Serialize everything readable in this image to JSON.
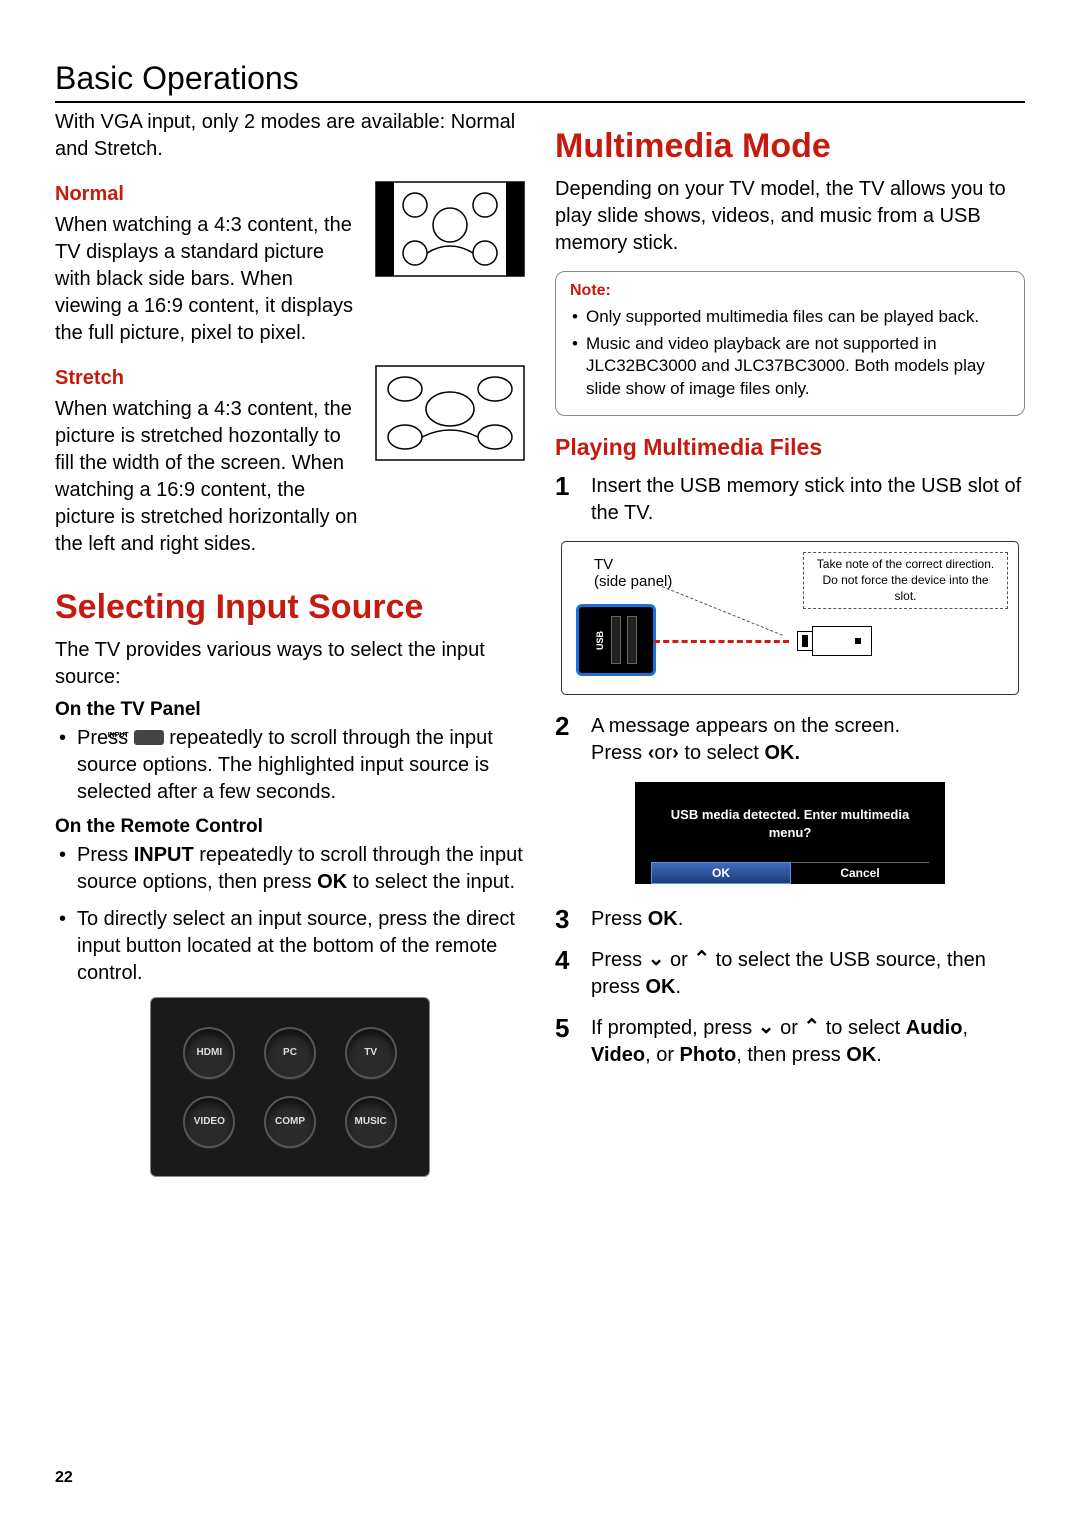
{
  "page_title": "Basic Operations",
  "page_number": "22",
  "left": {
    "intro": "With VGA input, only 2 modes are available: Normal and Stretch.",
    "normal": {
      "heading": "Normal",
      "text": "When watching a 4:3 content, the TV displays a standard picture with black side bars. When viewing a 16:9 content, it displays the full picture, pixel to pixel."
    },
    "stretch": {
      "heading": "Stretch",
      "text": "When watching a 4:3 content, the picture is stretched hozontally to fill the width of the screen. When watching a 16:9 content, the picture is stretched horizontally on the left and right sides."
    },
    "select_input": {
      "heading": "Selecting Input Source",
      "intro": "The TV provides various ways to select the input source:",
      "tv_panel": {
        "heading": "On the TV Panel",
        "bullet_pre": "Press ",
        "bullet_post": " repeatedly to scroll through the input source options. The highlighted input source is selected after a few seconds.",
        "input_label": "INPUT"
      },
      "remote": {
        "heading": "On the Remote Control",
        "b1_pre": "Press ",
        "b1_key": "INPUT",
        "b1_mid": " repeatedly to scroll through the input source options, then press ",
        "b1_key2": "OK",
        "b1_post": " to select the input.",
        "b2": "To directly select an input source, press the direct input button located at the bottom of the remote control."
      },
      "buttons": [
        "HDMI",
        "PC",
        "TV",
        "VIDEO",
        "COMP",
        "MUSIC"
      ]
    }
  },
  "right": {
    "mm_heading": "Multimedia Mode",
    "mm_intro": "Depending on your TV model, the TV allows you to play slide shows, videos, and music from a USB memory stick.",
    "note": {
      "title": "Note:",
      "items": [
        "Only supported multimedia files can be played back.",
        "Music and video playback are not supported in JLC32BC3000 and JLC37BC3000. Both models play slide show of image files only."
      ]
    },
    "playing_heading": "Playing Multimedia Files",
    "step1": "Insert the USB memory stick into the USB slot of the TV.",
    "usb": {
      "tv_label": "TV",
      "side_label": "(side panel)",
      "usb_label": "USB",
      "callout_l1": "Take note of the correct direction.",
      "callout_l2": "Do not force the device into the slot."
    },
    "step2_l1": "A message appears on the screen.",
    "step2_l2_pre": "Press ",
    "step2_l2_mid": "or",
    "step2_l2_post": " to select ",
    "step2_ok": "OK.",
    "dialog": {
      "msg": "USB media detected. Enter multimedia menu?",
      "ok": "OK",
      "cancel": "Cancel"
    },
    "step3_pre": "Press ",
    "step3_key": "OK",
    "step3_post": ".",
    "step4_pre": "Press ",
    "step4_mid1": " or ",
    "step4_mid2": " to select the USB source, then press ",
    "step4_key": "OK",
    "step4_post": ".",
    "step5_pre": "If prompted, press ",
    "step5_mid1": " or ",
    "step5_mid2": " to select ",
    "step5_audio": "Audio",
    "step5_c1": ", ",
    "step5_video": "Video",
    "step5_c2": ", or ",
    "step5_photo": "Photo",
    "step5_mid3": ", then press ",
    "step5_key": "OK",
    "step5_post": "."
  }
}
